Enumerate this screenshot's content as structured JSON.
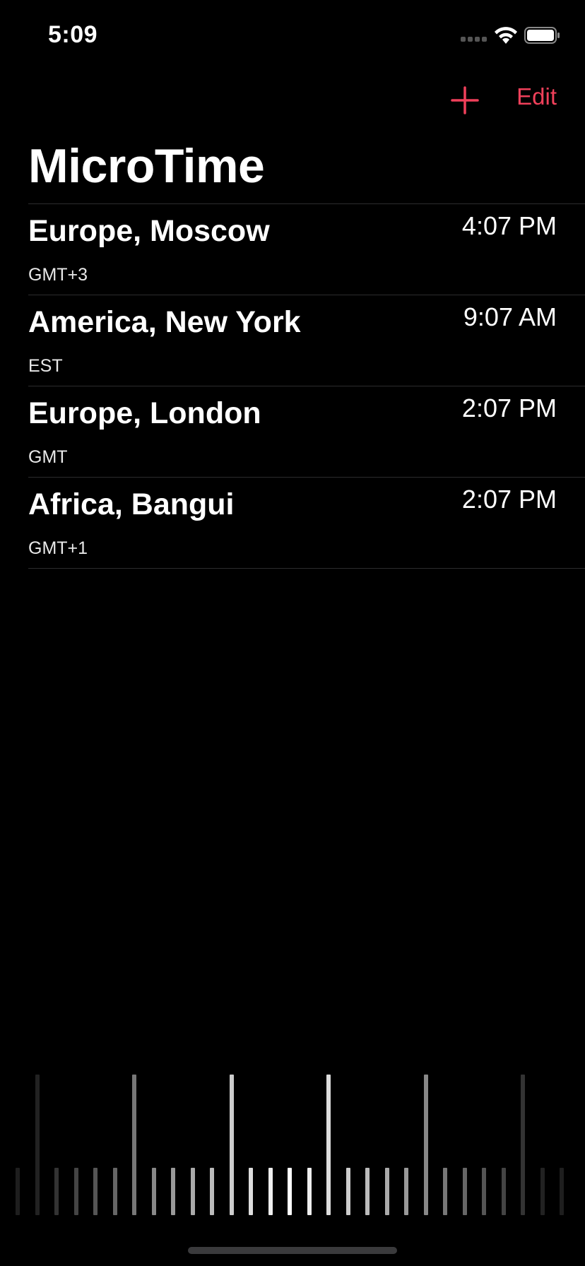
{
  "status_bar": {
    "time": "5:09"
  },
  "nav": {
    "edit_label": "Edit"
  },
  "title": "MicroTime",
  "timezones": [
    {
      "name": "Europe, Moscow",
      "abbr": "GMT+3",
      "time": "4:07 PM"
    },
    {
      "name": "America, New York",
      "abbr": "EST",
      "time": "9:07 AM"
    },
    {
      "name": "Europe, London",
      "abbr": "GMT",
      "time": "2:07 PM"
    },
    {
      "name": "Africa, Bangui",
      "abbr": "GMT+1",
      "time": "2:07 PM"
    }
  ],
  "icons": {
    "add": "plus-icon",
    "wifi": "wifi-icon",
    "battery": "battery-icon",
    "signal": "signal-icon"
  },
  "colors": {
    "accent": "#f0405a",
    "background": "#000000",
    "text": "#ffffff",
    "separator": "#2c2c2e"
  }
}
